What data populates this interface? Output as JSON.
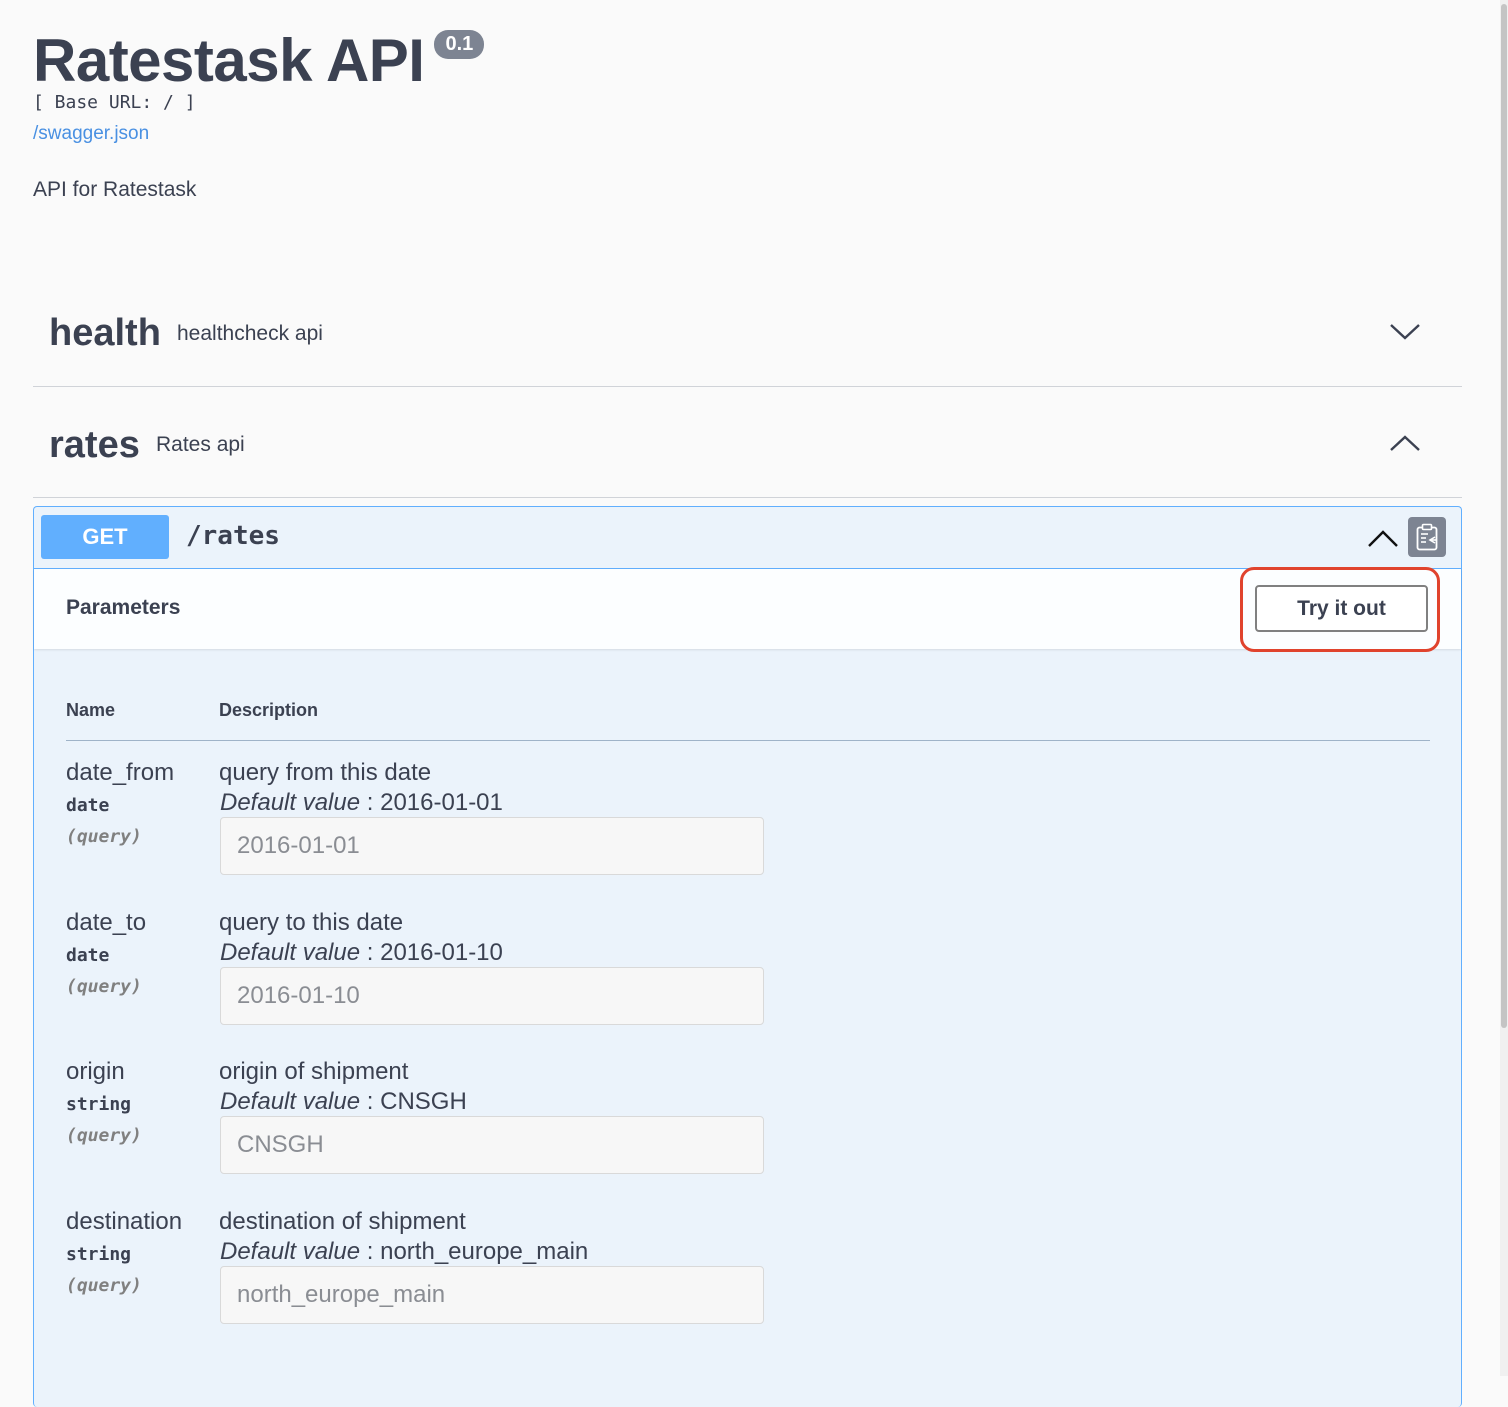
{
  "info": {
    "title": "Ratestask API",
    "version": "0.1",
    "base_url": "[ Base URL: / ]",
    "spec_link": "/swagger.json",
    "description": "API for Ratestask"
  },
  "tags": [
    {
      "name": "health",
      "description": "healthcheck api",
      "expanded": false
    },
    {
      "name": "rates",
      "description": "Rates api",
      "expanded": true
    }
  ],
  "operation": {
    "method": "GET",
    "path": "/rates",
    "parameters_title": "Parameters",
    "try_button": "Try it out",
    "columns": {
      "name": "Name",
      "description": "Description"
    },
    "default_label": "Default value",
    "params": [
      {
        "name": "date_from",
        "type": "date",
        "in": "(query)",
        "description": "query from this date",
        "default": "2016-01-01",
        "placeholder": "2016-01-01"
      },
      {
        "name": "date_to",
        "type": "date",
        "in": "(query)",
        "description": "query to this date",
        "default": "2016-01-10",
        "placeholder": "2016-01-10"
      },
      {
        "name": "origin",
        "type": "string",
        "in": "(query)",
        "description": "origin of shipment",
        "default": "CNSGH",
        "placeholder": "CNSGH"
      },
      {
        "name": "destination",
        "type": "string",
        "in": "(query)",
        "description": "destination of shipment",
        "default": "north_europe_main",
        "placeholder": "north_europe_main"
      }
    ]
  },
  "colors": {
    "get_accent": "#61affe",
    "opblock_bg": "#ebf3fb",
    "link": "#4990e2",
    "highlight": "#e0432d",
    "badge": "#7d8492"
  },
  "icons": {
    "tag_health_toggle": "chevron-down-icon",
    "tag_rates_toggle": "chevron-up-icon",
    "op_toggle": "chevron-up-icon",
    "copy": "clipboard-icon"
  }
}
